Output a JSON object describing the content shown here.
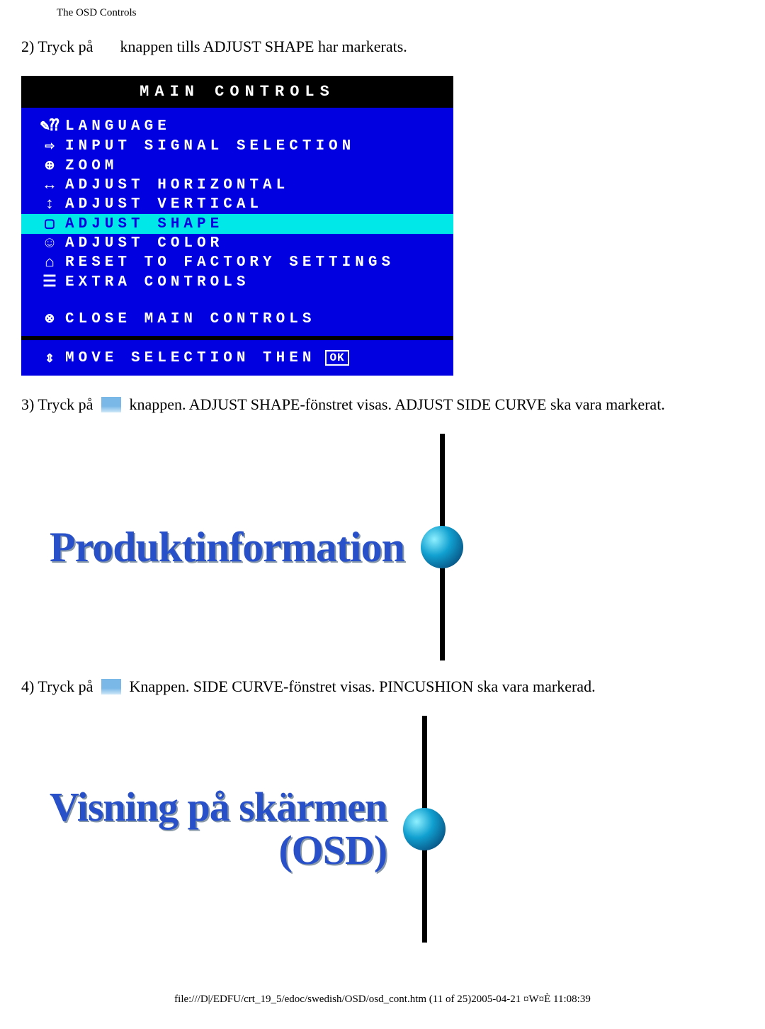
{
  "header": {
    "title": "The OSD Controls"
  },
  "steps": {
    "s2_a": "2) Tryck på",
    "s2_b": "knappen tills ADJUST SHAPE har markerats.",
    "s3_a": "3) Tryck på",
    "s3_b": "knappen. ADJUST SHAPE-fönstret visas. ADJUST SIDE CURVE ska vara markerat.",
    "s4_a": "4) Tryck på",
    "s4_b": "Knappen. SIDE CURVE-fönstret visas. PINCUSHION ska vara markerad."
  },
  "osd": {
    "title": "MAIN CONTROLS",
    "items": [
      {
        "icon": "✎⁇",
        "label": "LANGUAGE",
        "hi": false
      },
      {
        "icon": "⇨",
        "label": "INPUT SIGNAL SELECTION",
        "hi": false
      },
      {
        "icon": "⊕",
        "label": "ZOOM",
        "hi": false
      },
      {
        "icon": "↔",
        "label": "ADJUST HORIZONTAL",
        "hi": false
      },
      {
        "icon": "↕",
        "label": "ADJUST VERTICAL",
        "hi": false
      },
      {
        "icon": "▢",
        "label": "ADJUST SHAPE",
        "hi": true
      },
      {
        "icon": "☺",
        "label": "ADJUST COLOR",
        "hi": false
      },
      {
        "icon": "⌂",
        "label": "RESET TO FACTORY SETTINGS",
        "hi": false
      },
      {
        "icon": "☰",
        "label": "EXTRA CONTROLS",
        "hi": false
      }
    ],
    "close": {
      "icon": "⊗",
      "label": "CLOSE MAIN CONTROLS"
    },
    "footer": {
      "icon": "⇕",
      "label": "MOVE SELECTION THEN",
      "ok": "OK"
    }
  },
  "graphics": {
    "g1": "Produktinformation",
    "g2a": "Visning på skärmen",
    "g2b": "(OSD)"
  },
  "footer": {
    "text": "file:///D|/EDFU/crt_19_5/edoc/swedish/OSD/osd_cont.htm (11 of 25)2005-04-21 ¤W¤È 11:08:39"
  }
}
